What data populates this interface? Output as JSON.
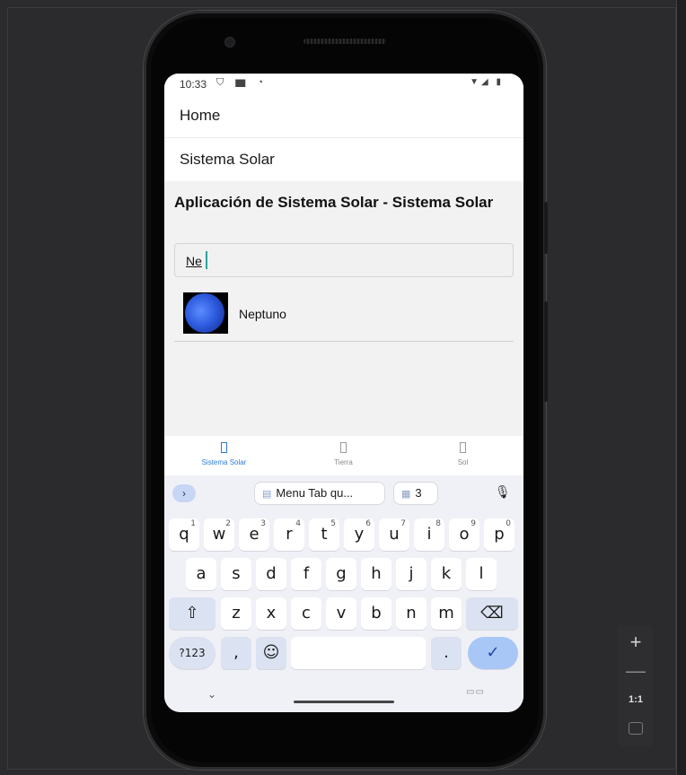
{
  "status_bar": {
    "time": "10:33",
    "left_icons": "⛉ ▆ ◔",
    "right_icons": "▼◢ ▮"
  },
  "menu": {
    "home": "Home",
    "solar": "Sistema Solar"
  },
  "app": {
    "title": "Aplicación de Sistema Solar - Sistema Solar",
    "search_value": "Ne",
    "results": [
      {
        "name": "Neptuno"
      }
    ]
  },
  "tabs": [
    {
      "label": "Sistema Solar",
      "active": true
    },
    {
      "label": "Tierra",
      "active": false
    },
    {
      "label": "Sol",
      "active": false
    }
  ],
  "keyboard": {
    "suggestion_clipboard": "Menu Tab qu...",
    "suggestion_number": "3",
    "row1": [
      "q",
      "w",
      "e",
      "r",
      "t",
      "y",
      "u",
      "i",
      "o",
      "p"
    ],
    "row1_sup": [
      "1",
      "2",
      "3",
      "4",
      "5",
      "6",
      "7",
      "8",
      "9",
      "0"
    ],
    "row2": [
      "a",
      "s",
      "d",
      "f",
      "g",
      "h",
      "j",
      "k",
      "l"
    ],
    "row3": [
      "z",
      "x",
      "c",
      "v",
      "b",
      "n",
      "m"
    ],
    "symbols_label": "?123",
    "comma": ",",
    "period": "."
  },
  "zoom": {
    "plus": "+",
    "minus": "—",
    "one_to_one": "1:1"
  },
  "colors": {
    "accent": "#2e7bd6",
    "enter_key": "#a9c7f6",
    "mod_key": "#dbe2f1"
  }
}
